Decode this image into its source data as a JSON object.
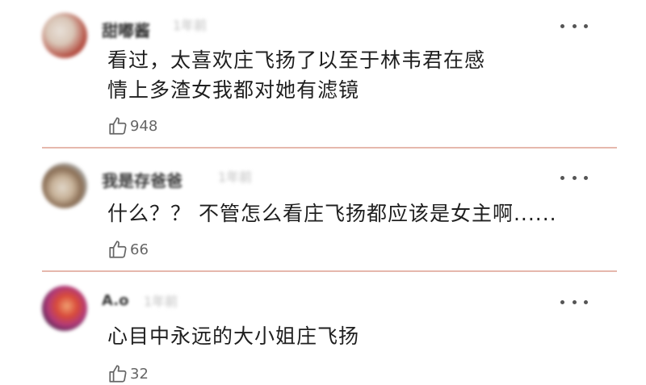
{
  "comments": [
    {
      "username": "甜嘟酱",
      "time": "1年前",
      "content": "看过，太喜欢庄飞扬了以至于林韦君在感情上多渣女我都对她有滤镜",
      "likes": "948",
      "avatar_colors": [
        "#d9c6b7",
        "#b34a3e",
        "#e8e0d8"
      ]
    },
    {
      "username": "我是存爸爸",
      "time": "1年前",
      "content": "什么？？ 不管怎么看庄飞扬都应该是女主啊......",
      "likes": "66",
      "avatar_colors": [
        "#b9c3c9",
        "#8a6e55",
        "#e0d6c8"
      ]
    },
    {
      "username": "A.o",
      "time": "1年前",
      "content": "心目中永远的大小姐庄飞扬",
      "likes": "32",
      "avatar_colors": [
        "#2a1f3d",
        "#d84a3a",
        "#b23a7a"
      ]
    }
  ],
  "divider_color": "#e6b8ad",
  "icons": {
    "like": "thumbs-up-icon",
    "more": "more-dots-icon"
  }
}
